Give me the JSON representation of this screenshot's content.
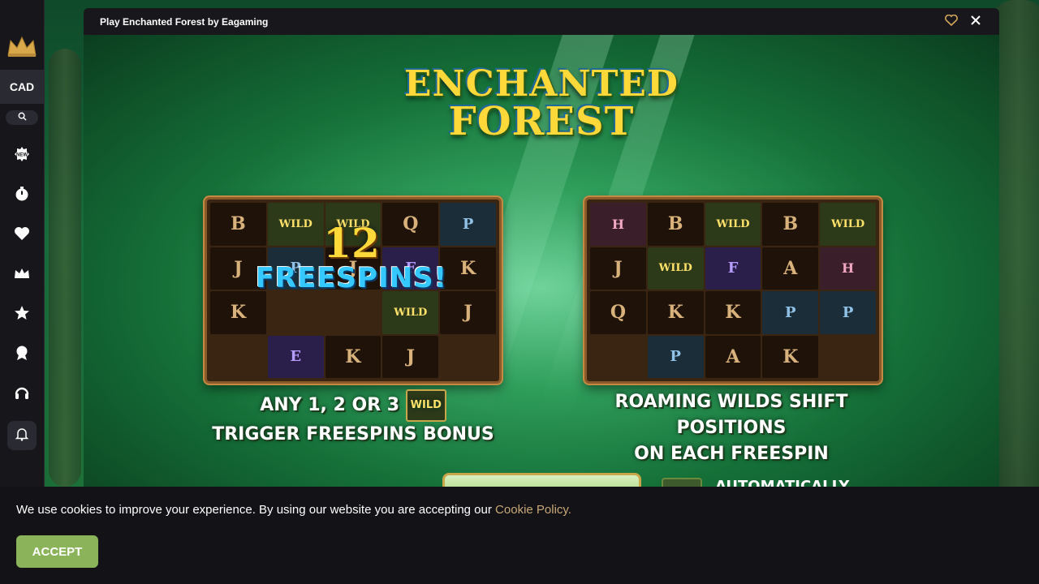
{
  "sidebar": {
    "currency": "CAD",
    "icons": [
      {
        "name": "new-badge-icon"
      },
      {
        "name": "stopwatch-icon"
      },
      {
        "name": "heart-icon"
      },
      {
        "name": "crown-icon"
      },
      {
        "name": "star-icon"
      },
      {
        "name": "trophy-icon"
      },
      {
        "name": "headset-icon"
      },
      {
        "name": "bell-icon"
      }
    ]
  },
  "modal": {
    "title": "Play Enchanted Forest by Eagaming"
  },
  "game": {
    "logo_line1": "ENCHANTED",
    "logo_line2": "FOREST",
    "freespins_count": "12",
    "freespins_text": "FREESPINS!",
    "caption_left_line1": "ANY  1, 2 OR 3",
    "caption_left_line2": "TRIGGER FREESPINS BONUS",
    "caption_right_line1": "ROAMING WILDS  SHIFT POSITIONS",
    "caption_right_line2": "ON EACH FREESPIN",
    "wild_label": "WILD",
    "auto_label": "AUTOMATICALLY",
    "left_reels": [
      [
        "B",
        "W",
        "W",
        "Q",
        "P"
      ],
      [
        "J",
        "P",
        "J",
        "F",
        "K"
      ],
      [
        "K",
        "",
        "",
        "W",
        "J"
      ],
      [
        "",
        "E",
        "K",
        "J",
        ""
      ]
    ],
    "right_reels": [
      [
        "H",
        "B",
        "W",
        "B",
        "W"
      ],
      [
        "J",
        "W",
        "F",
        "A",
        "H"
      ],
      [
        "Q",
        "K",
        "K",
        "P",
        "P"
      ],
      [
        "",
        "P",
        "A",
        "K",
        ""
      ]
    ]
  },
  "cookie": {
    "text": "We use cookies to improve your experience. By using our website you are accepting our",
    "link": "Cookie Policy.",
    "accept": "ACCEPT"
  },
  "colors": {
    "sidebar_bg": "#16161b",
    "accept_green": "#8bb45a",
    "link_gold": "#c9a877",
    "heart_gold": "#d4a55a"
  }
}
